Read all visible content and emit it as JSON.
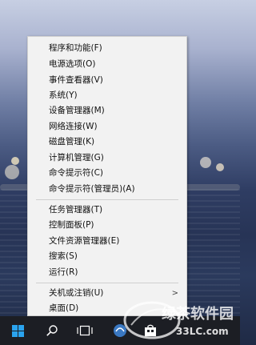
{
  "menu": {
    "items": [
      {
        "label": "程序和功能(F)"
      },
      {
        "label": "电源选项(O)"
      },
      {
        "label": "事件查看器(V)"
      },
      {
        "label": "系统(Y)"
      },
      {
        "label": "设备管理器(M)"
      },
      {
        "label": "网络连接(W)"
      },
      {
        "label": "磁盘管理(K)"
      },
      {
        "label": "计算机管理(G)"
      },
      {
        "label": "命令提示符(C)"
      },
      {
        "label": "命令提示符(管理员)(A)"
      },
      {
        "label": "任务管理器(T)"
      },
      {
        "label": "控制面板(P)"
      },
      {
        "label": "文件资源管理器(E)"
      },
      {
        "label": "搜索(S)"
      },
      {
        "label": "运行(R)"
      },
      {
        "label": "关机或注销(U)"
      },
      {
        "label": "桌面(D)"
      }
    ],
    "submenu_glyph": ">"
  },
  "taskbar": {
    "start_icon": "windows-logo-icon",
    "search_icon": "search-icon",
    "task_view_icon": "task-view-icon",
    "accent_color": "#2aa3ee"
  },
  "watermark": {
    "text": "绿茶软件园",
    "site": "33LC.com"
  }
}
